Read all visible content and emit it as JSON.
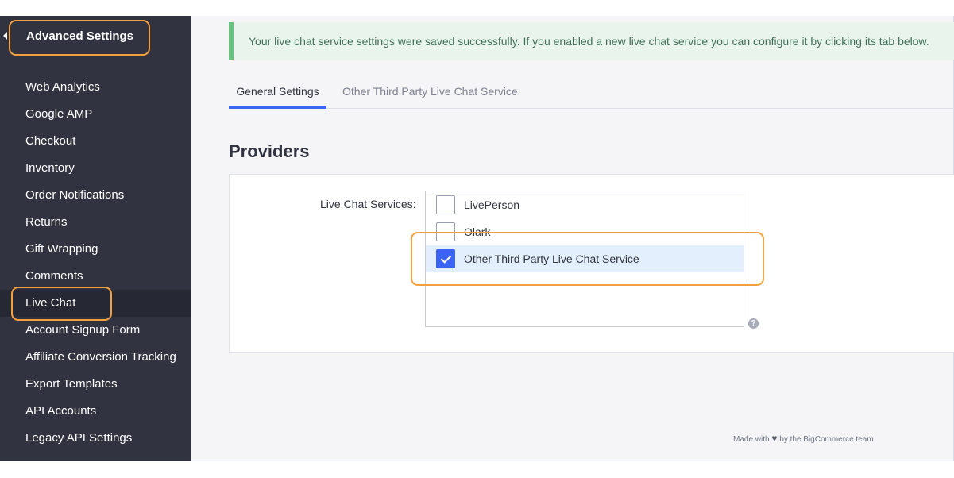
{
  "sidebar": {
    "title": "Advanced Settings",
    "items": [
      {
        "label": "Web Analytics"
      },
      {
        "label": "Google AMP"
      },
      {
        "label": "Checkout"
      },
      {
        "label": "Inventory"
      },
      {
        "label": "Order Notifications"
      },
      {
        "label": "Returns"
      },
      {
        "label": "Gift Wrapping"
      },
      {
        "label": "Comments"
      },
      {
        "label": "Live Chat"
      },
      {
        "label": "Account Signup Form"
      },
      {
        "label": "Affiliate Conversion Tracking"
      },
      {
        "label": "Export Templates"
      },
      {
        "label": "API Accounts"
      },
      {
        "label": "Legacy API Settings"
      }
    ],
    "active_item": "Live Chat"
  },
  "alert": {
    "message": "Your live chat service settings were saved successfully. If you enabled a new live chat service you can configure it by clicking its tab below."
  },
  "tabs": [
    {
      "label": "General Settings",
      "active": true
    },
    {
      "label": "Other Third Party Live Chat Service",
      "active": false
    }
  ],
  "main": {
    "section_title": "Providers",
    "field_label": "Live Chat Services:",
    "options": [
      {
        "label": "LivePerson",
        "checked": false
      },
      {
        "label": "Olark",
        "checked": false
      },
      {
        "label": "Other Third Party Live Chat Service",
        "checked": true
      }
    ],
    "help_glyph": "?"
  },
  "footer": {
    "prefix": "Made with",
    "icon": "heart-icon",
    "suffix": "by the BigCommerce team"
  },
  "colors": {
    "sidebar_bg": "#313440",
    "accent": "#3c64f4",
    "highlight": "#f4a040",
    "success": "#6ac07f"
  }
}
